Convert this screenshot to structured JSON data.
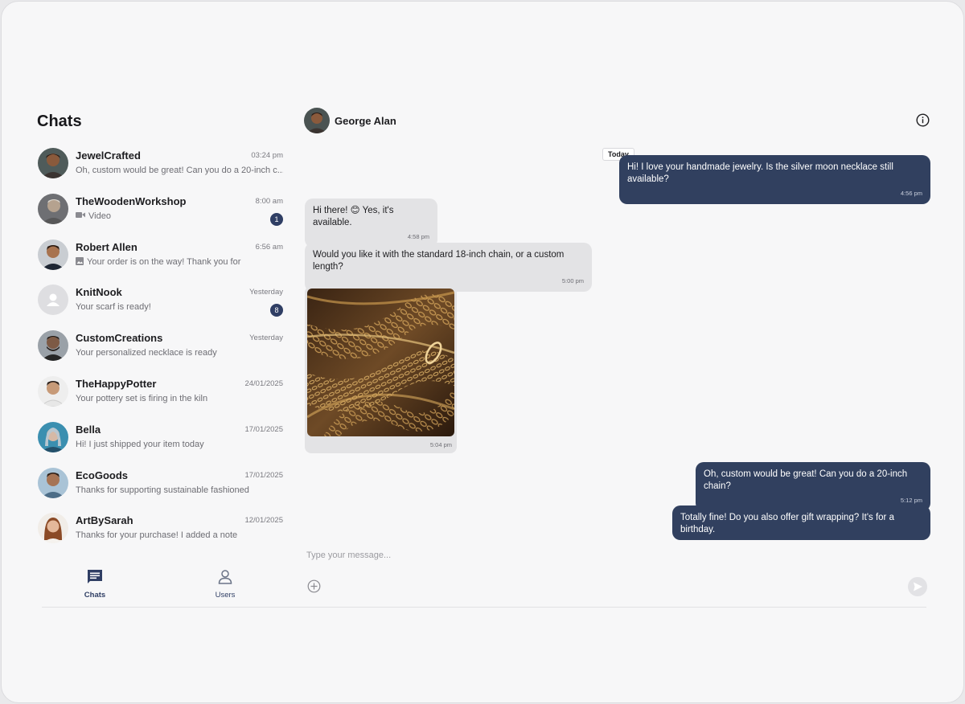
{
  "sidebar": {
    "title": "Chats",
    "chats": [
      {
        "name": "JewelCrafted",
        "time": "03:24 pm",
        "preview": "Oh, custom would be great! Can you do a 20-inch c...",
        "preview_icon": "",
        "badge": "",
        "avatar_icon": "person-photo"
      },
      {
        "name": "TheWoodenWorkshop",
        "time": "8:00 am",
        "preview": "Video",
        "preview_icon": "video-icon",
        "badge": "1",
        "avatar_icon": "person-photo"
      },
      {
        "name": "Robert Allen",
        "time": "6:56 am",
        "preview": "Your order is on the way! Thank you for",
        "preview_icon": "image-icon",
        "badge": "",
        "avatar_icon": "person-photo"
      },
      {
        "name": "KnitNook",
        "time": "Yesterday",
        "preview": "Your scarf is ready!",
        "preview_icon": "",
        "badge": "8",
        "avatar_icon": "default-user-icon"
      },
      {
        "name": "CustomCreations",
        "time": "Yesterday",
        "preview": "Your personalized necklace is ready",
        "preview_icon": "",
        "badge": "",
        "avatar_icon": "person-photo"
      },
      {
        "name": "TheHappyPotter",
        "time": "24/01/2025",
        "preview": "Your pottery set is firing in the kiln",
        "preview_icon": "",
        "badge": "",
        "avatar_icon": "person-photo"
      },
      {
        "name": "Bella",
        "time": "17/01/2025",
        "preview": "Hi! I just shipped your item today",
        "preview_icon": "",
        "badge": "",
        "avatar_icon": "person-photo"
      },
      {
        "name": "EcoGoods",
        "time": "17/01/2025",
        "preview": "Thanks for supporting sustainable fashioned",
        "preview_icon": "",
        "badge": "",
        "avatar_icon": "person-photo"
      },
      {
        "name": "ArtBySarah",
        "time": "12/01/2025",
        "preview": "Thanks for your purchase! I added a note",
        "preview_icon": "",
        "badge": "",
        "avatar_icon": "person-photo"
      }
    ]
  },
  "nav": {
    "chats_label": "Chats",
    "users_label": "Users"
  },
  "conversation": {
    "contact_name": "George Alan",
    "date_chip": "Today",
    "messages": [
      {
        "direction": "out",
        "text": "Hi! I love your handmade jewelry. Is the silver moon necklace still available?",
        "time": "4:56 pm"
      },
      {
        "direction": "in",
        "text": "Hi there! 😊 Yes, it's available.",
        "time": "4:58 pm"
      },
      {
        "direction": "in",
        "text": "Would you like it with the standard 18-inch chain, or a custom length?",
        "time": "5:00 pm"
      },
      {
        "direction": "in",
        "type": "image",
        "image": "gold-chains-photo",
        "time": "5:04 pm"
      },
      {
        "direction": "out",
        "text": "Oh, custom would be great! Can you do a 20-inch chain?",
        "time": "5:12 pm"
      },
      {
        "direction": "out",
        "text": "Totally fine! Do you also offer gift wrapping? It's for a birthday.",
        "time": ""
      }
    ]
  },
  "composer": {
    "placeholder": "Type your message..."
  },
  "colors": {
    "accent": "#31405f",
    "incoming_bubble": "#e3e3e5",
    "background": "#f7f7f8"
  }
}
